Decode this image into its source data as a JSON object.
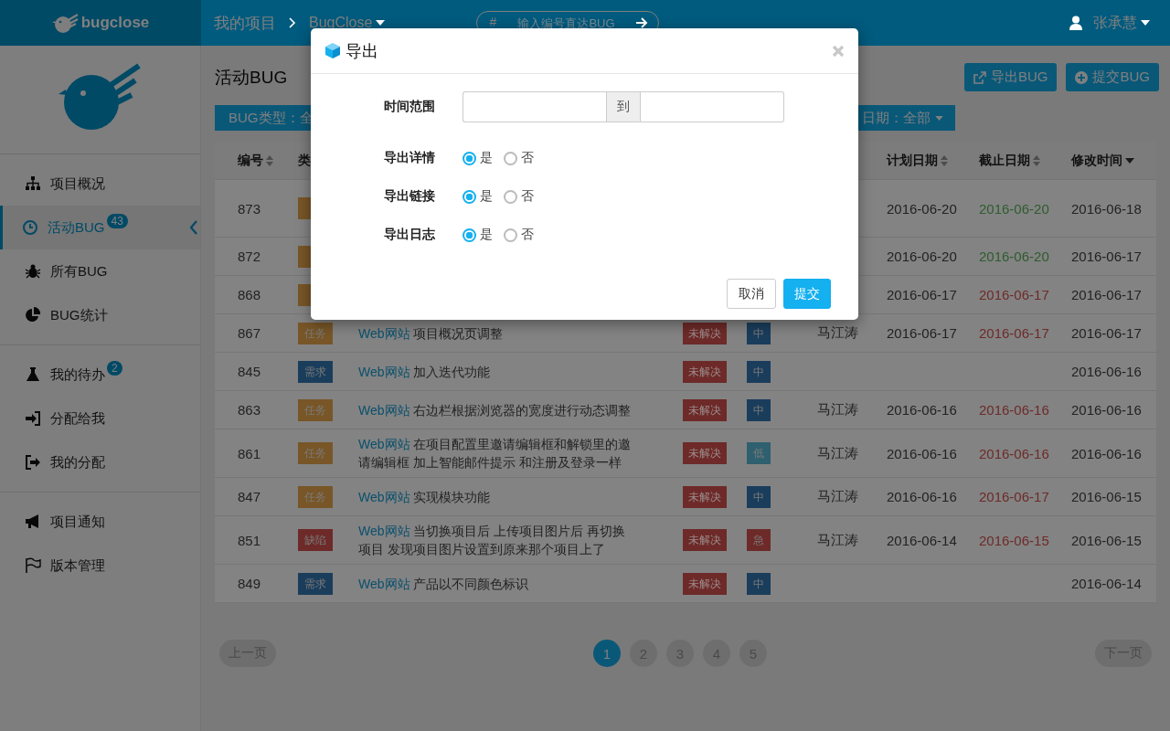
{
  "topbar": {
    "logo": "bugclose",
    "breadcrumb": [
      "我的项目",
      "BugClose"
    ],
    "search": {
      "prefix": "#",
      "placeholder": "输入编号直达BUG"
    },
    "user": "张承慧"
  },
  "sidebar": {
    "groups": [
      [
        {
          "label": "项目概况",
          "selected": false
        },
        {
          "label": "活动BUG",
          "selected": true,
          "badge": "43"
        },
        {
          "label": "所有BUG",
          "selected": false
        },
        {
          "label": "BUG统计",
          "selected": false
        }
      ],
      [
        {
          "label": "我的待办",
          "selected": false,
          "badge": "2"
        },
        {
          "label": "分配给我",
          "selected": false
        },
        {
          "label": "我的分配",
          "selected": false
        }
      ],
      [
        {
          "label": "项目通知",
          "selected": false
        },
        {
          "label": "版本管理",
          "selected": false
        }
      ]
    ]
  },
  "page": {
    "title": "活动BUG",
    "buttons": [
      "导出BUG",
      "提交BUG"
    ],
    "filters": [
      "BUG类型：全",
      "日期：全部"
    ],
    "table": {
      "columns": [
        {
          "label": "编号",
          "kind": "sortable"
        },
        {
          "label": "类",
          "kind": "plain"
        },
        {
          "label": "计划日期",
          "kind": "sortable"
        },
        {
          "label": "截止日期",
          "kind": "sortable"
        },
        {
          "label": "修改时间",
          "kind": "sorted-desc"
        }
      ],
      "rows": [
        {
          "id": "873",
          "type": {
            "kind": "task"
          },
          "plan": "2016-06-20",
          "due": {
            "text": "2016-06-20",
            "color": "#2e5c2e"
          },
          "modified": "2016-06-18"
        },
        {
          "id": "872",
          "type": {
            "kind": "task"
          },
          "plan": "2016-06-20",
          "due": {
            "text": "2016-06-20",
            "color": "#2e5c2e"
          },
          "modified": "2016-06-17"
        },
        {
          "id": "868",
          "type": {
            "kind": "task"
          },
          "plan": "2016-06-17",
          "due": {
            "text": "2016-06-17",
            "color": "#6d2a28"
          },
          "modified": "2016-06-17"
        },
        {
          "id": "867",
          "type": {
            "label": "任务",
            "kind": "task"
          },
          "title": {
            "link": "Web网站",
            "text": "项目概况页调整"
          },
          "status": "未解决",
          "priority": {
            "label": "中",
            "kind": "medium"
          },
          "assignee": "马江涛",
          "plan": "2016-06-17",
          "due": {
            "text": "2016-06-17",
            "color": "#6d2a28"
          },
          "modified": "2016-06-17"
        },
        {
          "id": "845",
          "type": {
            "label": "需求",
            "kind": "requirement"
          },
          "title": {
            "link": "Web网站",
            "text": "加入迭代功能"
          },
          "status": "未解决",
          "priority": {
            "label": "中",
            "kind": "medium"
          },
          "modified": "2016-06-16"
        },
        {
          "id": "863",
          "type": {
            "label": "任务",
            "kind": "task"
          },
          "title": {
            "link": "Web网站",
            "text": "右边栏根据浏览器的宽度进行动态调整"
          },
          "status": "未解决",
          "priority": {
            "label": "中",
            "kind": "medium"
          },
          "assignee": "马江涛",
          "plan": "2016-06-16",
          "due": {
            "text": "2016-06-16",
            "color": "#6d2a28"
          },
          "modified": "2016-06-16"
        },
        {
          "id": "861",
          "type": {
            "label": "任务",
            "kind": "task"
          },
          "title": {
            "link": "Web网站",
            "text": "在项目配置里邀请编辑框和解锁里的邀请编辑框 加上智能邮件提示 和注册及登录一样"
          },
          "status": "未解决",
          "priority": {
            "label": "低",
            "kind": "low"
          },
          "assignee": "马江涛",
          "plan": "2016-06-16",
          "due": {
            "text": "2016-06-16",
            "color": "#6d2a28"
          },
          "modified": "2016-06-16"
        },
        {
          "id": "847",
          "type": {
            "label": "任务",
            "kind": "task"
          },
          "title": {
            "link": "Web网站",
            "text": "实现模块功能"
          },
          "status": "未解决",
          "priority": {
            "label": "中",
            "kind": "medium"
          },
          "assignee": "马江涛",
          "plan": "2016-06-16",
          "due": {
            "text": "2016-06-17",
            "color": "#6d2a28"
          },
          "modified": "2016-06-15"
        },
        {
          "id": "851",
          "type": {
            "label": "缺陷",
            "kind": "defect"
          },
          "title": {
            "link": "Web网站",
            "text": "当切换项目后 上传项目图片后 再切换项目 发现项目图片设置到原来那个项目上了"
          },
          "status": "未解决",
          "priority": {
            "label": "急",
            "kind": "urgent"
          },
          "assignee": "马江涛",
          "plan": "2016-06-14",
          "due": {
            "text": "2016-06-15",
            "color": "#6d2a28"
          },
          "modified": "2016-06-15"
        },
        {
          "id": "849",
          "type": {
            "label": "需求",
            "kind": "requirement"
          },
          "title": {
            "link": "Web网站",
            "text": "产品以不同颜色标识"
          },
          "status": "未解决",
          "priority": {
            "label": "中",
            "kind": "medium"
          },
          "modified": "2016-06-14"
        }
      ]
    },
    "pagination": {
      "prev": "上一页",
      "pages": [
        {
          "label": "1",
          "selected": true
        },
        {
          "label": "2",
          "selected": false
        },
        {
          "label": "3",
          "selected": false
        },
        {
          "label": "4",
          "selected": false
        },
        {
          "label": "5",
          "selected": false
        }
      ],
      "next": "下一页"
    }
  },
  "modal": {
    "title": "导出",
    "fields": [
      {
        "kind": "range",
        "label": "时间范围",
        "separator": "到"
      },
      {
        "kind": "radio",
        "label": "导出详情",
        "options": [
          {
            "label": "是",
            "selected": true
          },
          {
            "label": "否",
            "selected": false
          }
        ]
      },
      {
        "kind": "radio",
        "label": "导出链接",
        "options": [
          {
            "label": "是",
            "selected": true
          },
          {
            "label": "否",
            "selected": false
          }
        ]
      },
      {
        "kind": "radio",
        "label": "导出日志",
        "options": [
          {
            "label": "是",
            "selected": true
          },
          {
            "label": "否",
            "selected": false
          }
        ]
      }
    ],
    "buttons": [
      {
        "label": "取消",
        "kind": "default"
      },
      {
        "label": "提交",
        "kind": "primary"
      }
    ]
  }
}
